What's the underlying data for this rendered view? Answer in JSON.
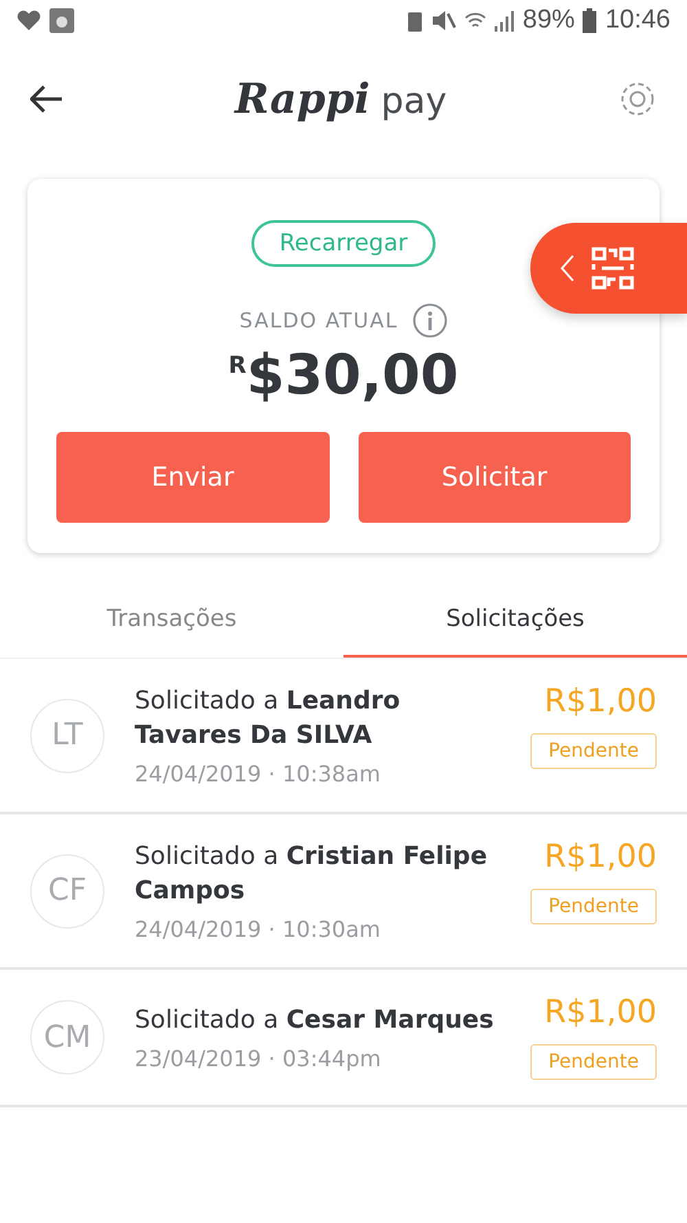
{
  "status_bar": {
    "battery": "89%",
    "time": "10:46"
  },
  "header": {
    "logo": "Rappi",
    "logo_suffix": "pay"
  },
  "balance_card": {
    "recharge_button": "Recarregar",
    "label": "SALDO ATUAL",
    "currency_mark": "R",
    "amount": "$30,00",
    "actions": [
      "Enviar",
      "Solicitar"
    ]
  },
  "tabs": [
    {
      "label": "Transações",
      "selected": false
    },
    {
      "label": "Solicitações",
      "selected": true
    }
  ],
  "requests": [
    {
      "initials": "LT",
      "text": "Solicitado a **Leandro Tavares Da SILVA**",
      "date": "24/04/2019 · 10:38am",
      "amount": "R$1,00",
      "status": "Pendente"
    },
    {
      "initials": "CF",
      "text": "Solicitado a **Cristian Felipe Campos**",
      "date": "24/04/2019 · 10:30am",
      "amount": "R$1,00",
      "status": "Pendente"
    },
    {
      "initials": "CM",
      "text": "Solicitado a **Cesar Marques**",
      "date": "23/04/2019 · 03:44pm",
      "amount": "R$1,00",
      "status": "Pendente"
    }
  ]
}
